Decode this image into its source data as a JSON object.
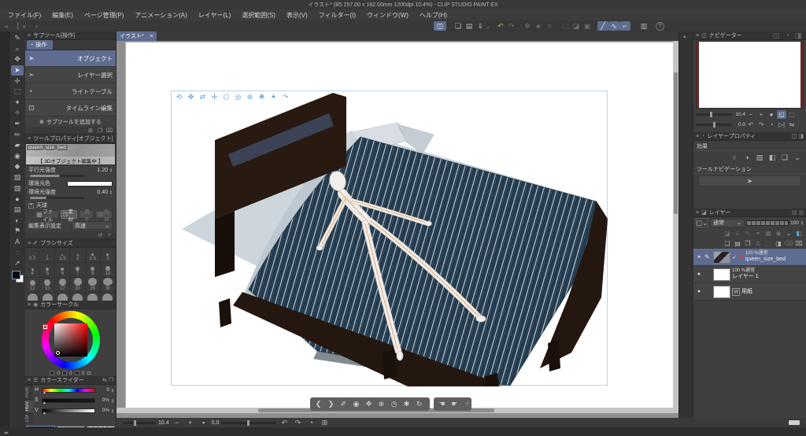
{
  "window": {
    "title": "イラスト* (B5 257.00 x 182.00mm 1200dpi 10.4%)  - CLIP STUDIO PAINT EX"
  },
  "menu": {
    "items": [
      "ファイル(F)",
      "編集(E)",
      "ページ管理(P)",
      "アニメーション(A)",
      "レイヤー(L)",
      "選択範囲(S)",
      "表示(V)",
      "フィルター(I)",
      "ウィンドウ(W)",
      "ヘルプ(H)"
    ]
  },
  "canvas": {
    "tab": "イラスト*",
    "close": "×"
  },
  "colors": {
    "accent": "#5d6c90",
    "gizmo_blue": "#5b9fd4",
    "selection_red": "#e03b3b"
  },
  "subtool": {
    "title": "サブツール[操作]",
    "group": "操作",
    "items": [
      "オブジェクト",
      "レイヤー選択",
      "ライトテーブル",
      "タイムライン編集"
    ],
    "add": "サブツールを追加する"
  },
  "toolprop": {
    "title": "ツールプロパティ[オブジェクト]",
    "preview": "queen_size_bed",
    "editing": "【 3Dオブジェクト編集中 】",
    "light_label": "平行光強度",
    "light_value": "1.20",
    "ambient_color_label": "環境光色",
    "ambient_label": "環境光強度",
    "ambient_value": "0.40",
    "sky_label": "天球",
    "sky_buttons": [
      "ファイル",
      "素材",
      "再生",
      "削除"
    ],
    "display_label": "編集表示設定",
    "display_value": "高速"
  },
  "brush": {
    "title": "ブラシサイズ",
    "sizes": [
      "0.7",
      "1",
      "1.5",
      "2",
      "2.5",
      "3",
      "4",
      "5",
      "6",
      "7",
      "8",
      "10",
      "12",
      "15",
      "17",
      "20",
      "25",
      "30"
    ]
  },
  "wheel": {
    "title": "カラーサークル",
    "readout": [
      "0",
      "0",
      "0"
    ]
  },
  "sliderp": {
    "title": "カラースライダー",
    "tabs": [
      "RGB",
      "HSV",
      "CM"
    ],
    "h_label": "H",
    "h_value": "0",
    "s_label": "S",
    "s_value": "0%",
    "v_label": "V",
    "v_value": "0%"
  },
  "navigator": {
    "title": "ナビゲーター",
    "zoom": "10.4",
    "rotation": "0.0"
  },
  "layerprop": {
    "title": "レイヤープロパティ",
    "effect": "効果",
    "toolnav": "ツールナビゲーション"
  },
  "layers": {
    "title": "レイヤー",
    "blend": "通常",
    "opacity": "100",
    "rows": [
      {
        "meta": "100 %通常",
        "name": "queen_size_bed"
      },
      {
        "meta": "100 %通常",
        "name": "レイヤー 1"
      },
      {
        "meta": "",
        "name": "用紙"
      }
    ]
  },
  "status": {
    "zoom": "10.4",
    "rotation": "0.0"
  },
  "icons": {
    "cmdbar": [
      "◫",
      "❏",
      "▤",
      "⇓",
      "↶",
      "↷",
      "✻",
      "◈",
      "⌗",
      "⬚",
      "◪",
      "▣",
      "╱",
      "∿",
      "⌐",
      "▥",
      "?"
    ],
    "toolstrip": [
      "✎",
      "⌕",
      "✥",
      "➤",
      "✛",
      "⬚",
      "✦",
      "✧",
      "✒",
      "✏",
      "▰",
      "◉",
      "◆",
      "▨",
      "▧",
      "●",
      "▤",
      "◐",
      "⚑",
      "A",
      "◌",
      "➚"
    ],
    "subtool_footer": [
      "⊞",
      "❐",
      "⌧"
    ],
    "toolprop_footer": [
      "↺",
      "⌕"
    ],
    "gizmo": [
      "⟲",
      "✥",
      "⇄",
      "✛",
      "⬡",
      "◎",
      "⊛",
      "❋",
      "✦",
      "↷"
    ],
    "float1": [
      "❮",
      "❯",
      "✐",
      "◉",
      "✥",
      "⊕",
      "◷",
      "✱",
      "↻"
    ],
    "float2": [
      "☚",
      "☛",
      "☝"
    ],
    "nav_tabs": [
      "◫",
      "◔",
      "◨"
    ],
    "nav_zoom": [
      "−",
      "+",
      "●",
      "◱",
      "⬚"
    ],
    "nav_rot": [
      "↶",
      "↷",
      "◔",
      "▷|",
      "⇋"
    ],
    "effects": [
      "○",
      "◑",
      "▨",
      "◧",
      "❏",
      "⌄"
    ],
    "toolnav_icon": "➤",
    "layers_bar1": [
      "◪",
      "⇩",
      "✎",
      "✦",
      "▦",
      "◉",
      "⌄",
      "◧"
    ],
    "layers_bar2": [
      "❏",
      "▤",
      "❐",
      "⚓",
      "⬚",
      "◨",
      "⌫",
      "⌧"
    ],
    "check": "✓",
    "red_x": "✖",
    "pencil": "✎",
    "eye": "●",
    "plus": "+"
  }
}
